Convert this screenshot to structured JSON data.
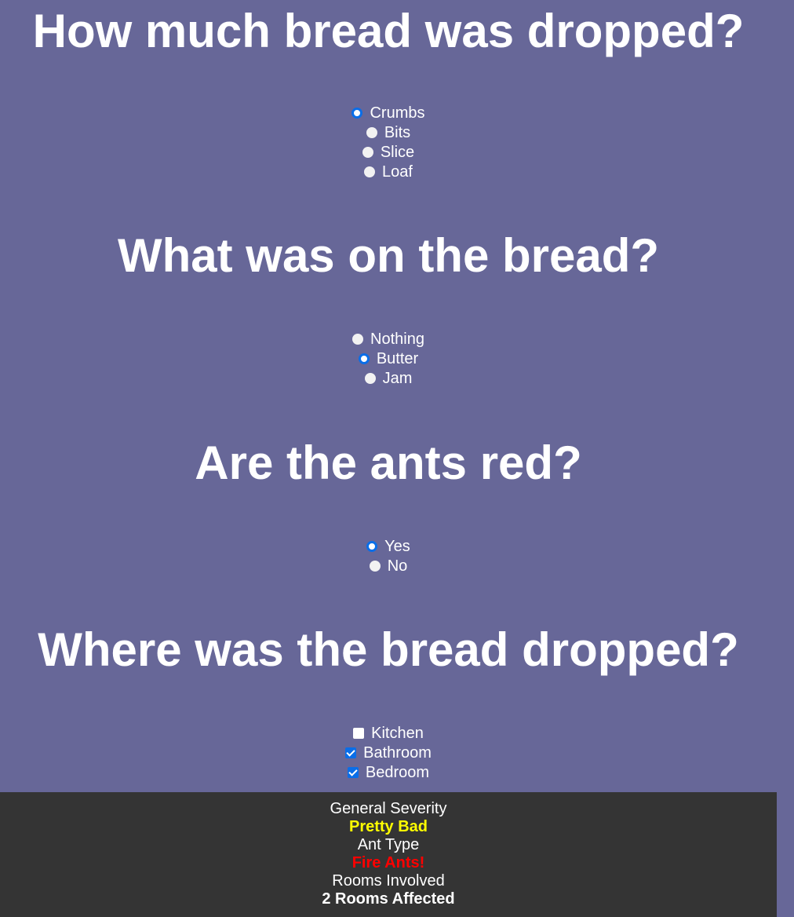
{
  "questions": [
    {
      "title": "How much bread was dropped?",
      "type": "radio",
      "options": [
        {
          "label": "Crumbs",
          "checked": true
        },
        {
          "label": "Bits",
          "checked": false
        },
        {
          "label": "Slice",
          "checked": false
        },
        {
          "label": "Loaf",
          "checked": false
        }
      ]
    },
    {
      "title": "What was on the bread?",
      "type": "radio",
      "options": [
        {
          "label": "Nothing",
          "checked": false
        },
        {
          "label": "Butter",
          "checked": true
        },
        {
          "label": "Jam",
          "checked": false
        }
      ]
    },
    {
      "title": "Are the ants red?",
      "type": "radio",
      "options": [
        {
          "label": "Yes",
          "checked": true
        },
        {
          "label": "No",
          "checked": false
        }
      ]
    },
    {
      "title": "Where was the bread dropped?",
      "type": "checkbox",
      "options": [
        {
          "label": "Kitchen",
          "checked": false
        },
        {
          "label": "Bathroom",
          "checked": true
        },
        {
          "label": "Bedroom",
          "checked": true
        }
      ]
    }
  ],
  "results": {
    "severity_label": "General Severity",
    "severity_value": "Pretty Bad",
    "severity_color": "#ffff00",
    "ant_type_label": "Ant Type",
    "ant_type_value": "Fire Ants!",
    "ant_type_color": "#ff0000",
    "rooms_label": "Rooms Involved",
    "rooms_value": "2 Rooms Affected",
    "rooms_color": "#ffffff"
  },
  "colors": {
    "background": "#676798",
    "results_background": "#343434",
    "accent": "#0a6ee8"
  }
}
